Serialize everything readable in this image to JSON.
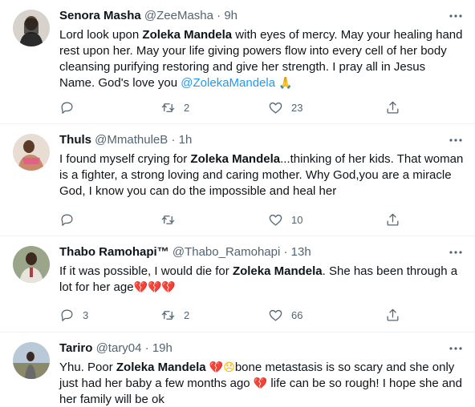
{
  "tweets": [
    {
      "name": "Senora Masha",
      "handle": "@ZeeMasha",
      "dot": "·",
      "time": "9h",
      "text": {
        "a": "Lord look upon ",
        "b": "Zoleka Mandela",
        "c": " with eyes of mercy. May your healing hand rest upon her. May your life giving powers flow into every cell of her body cleansing purifying restoring and give her strength. I pray all in Jesus Name. God's love you ",
        "mention": "@ZolekaMandela",
        "emoji": "🙏"
      },
      "replies": "",
      "retweets": "2",
      "likes": "23",
      "avatar_color": "#3a3a3a"
    },
    {
      "name": "Thuls",
      "handle": "@MmathuleB",
      "dot": "·",
      "time": "1h",
      "text": {
        "a": "I found myself crying for ",
        "b": "Zoleka Mandela",
        "c": "...thinking of her kids. That woman is a fighter, a strong loving and caring mother. Why God,you are a miracle God, I know you can do the impossible and heal her"
      },
      "replies": "",
      "retweets": "",
      "likes": "10",
      "avatar_color": "#c98a6a"
    },
    {
      "name": "Thabo Ramohapi™",
      "handle": "@Thabo_Ramohapi",
      "dot": "·",
      "time": "13h",
      "text": {
        "a": "If it was possible, I would die for ",
        "b": "Zoleka Mandela",
        "c": ". She has been through a lot for her age",
        "emoji": "💔💔💔"
      },
      "replies": "3",
      "retweets": "2",
      "likes": "66",
      "avatar_color": "#6b7a5a"
    },
    {
      "name": "Tariro",
      "handle": "@tary04",
      "dot": "·",
      "time": "19h",
      "text": {
        "a": "Yhu. Poor ",
        "b": "Zoleka Mandela",
        "emoji1": "💔",
        "emoji2": "😞",
        "c": "bone metastasis is so scary and she only just had her baby a few months ago ",
        "emoji3": "💔",
        "d": " life can be so rough! I hope she and her family will be ok"
      },
      "avatar_color": "#a8b8c8"
    }
  ],
  "icons": {
    "reply": "reply-icon",
    "retweet": "retweet-icon",
    "like": "heart-icon",
    "share": "share-icon",
    "more": "more-icon"
  },
  "colors": {
    "accent": "#1d9bf0",
    "muted": "#536471",
    "text": "#0f1419",
    "heart_emoji": "#e0245e"
  }
}
